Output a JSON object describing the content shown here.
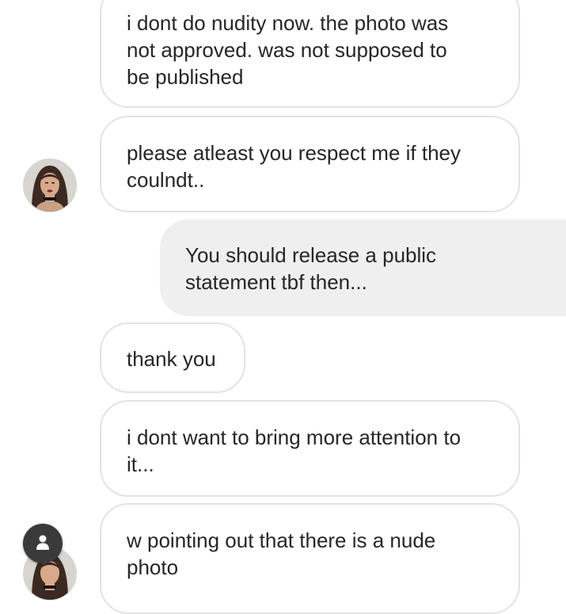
{
  "colors": {
    "background": "#ffffff",
    "incoming_border": "#e3e3e3",
    "outgoing_fill": "#efefef",
    "text": "#262626",
    "scroll_button": "#3a3a3a"
  },
  "messages": [
    {
      "direction": "incoming",
      "text": "i dont do nudity now. the photo was\nnot approved. was not supposed to\nbe published"
    },
    {
      "direction": "incoming",
      "text": "please atleast you respect me if they\ncoulndt.."
    },
    {
      "direction": "outgoing",
      "text": "You should release a public\nstatement tbf then..."
    },
    {
      "direction": "incoming",
      "text": "thank you"
    },
    {
      "direction": "incoming",
      "text": "i dont want to bring more attention to\nit..."
    },
    {
      "direction": "incoming",
      "text": "w pointing out that there is a nude\nphoto"
    }
  ],
  "icons": {
    "avatar": "profile-photo",
    "scroll_button": "person-icon"
  }
}
